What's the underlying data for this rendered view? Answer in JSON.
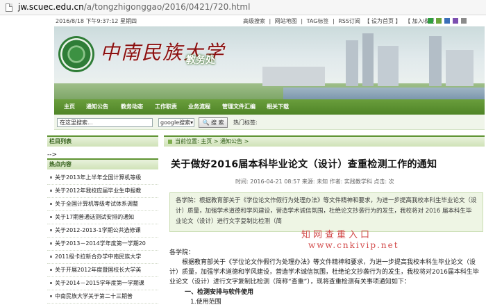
{
  "browser": {
    "url_host": "jw.scuec.edu.cn",
    "url_path": "/a/tongzhigonggao/2016/0421/720.html"
  },
  "topbar": {
    "datetime": "2016/8/18 下午9:37:12 星期四",
    "links": [
      "高级搜索",
      "|",
      "网站地图",
      "|",
      "TAG标签",
      "|",
      "RSS订阅",
      "【 设为首页 】",
      "【 加入收藏 】"
    ],
    "swatch_colors": [
      "#2e9e3e",
      "#6aa53a",
      "#3a6fb8",
      "#7c4fb0",
      "#8b8b8b"
    ]
  },
  "banner": {
    "university_name": "中南民族大学",
    "department": "教务处"
  },
  "nav": {
    "items": [
      "主页",
      "通知公告",
      "教务动态",
      "工作职责",
      "业务流程",
      "管理文件汇编",
      "相关下载"
    ]
  },
  "search": {
    "placeholder": "在这里搜索...",
    "engine": "google搜索",
    "button": "搜 索",
    "hot_label": "热门标签:"
  },
  "sidebar": {
    "column_header": "栏目列表",
    "arrow_text": "-->",
    "hot_header": "热点内容",
    "items": [
      "关于2013年上半年全国计算机等级",
      "关于2012年我校应届毕业生申报教",
      "关于全国计算机等级考试体系调整",
      "关于17期普通话测试安排的通知",
      "关于2012-2013-1学期公共选修课",
      "关于2013－2014学年度第一学期20",
      "2011级卡拉新合办学中南民族大学",
      "关于开展2012年度暨国校长大学英",
      "关于2014－2015学年度第一学期课",
      "中南民族大学关于第二十三期普"
    ]
  },
  "breadcrumb": {
    "label": "当前位置:",
    "home": "主页",
    "sep1": ">",
    "section": "通知公告",
    "sep2": ">"
  },
  "article": {
    "title": "关于做好2016届本科毕业论文（设计）查重检测工作的通知",
    "meta": "时间: 2016-04-21 08:57  来源: 未知  作者: 实践教学科  点击: 次",
    "summary": "各学院：根据教育部关于《学位论文作假行为处理办法》等文件精神和要求，为进一步提高我校本科生毕业论文（设计）质量，加强学术道德和学风建设，营造学术诚信氛围，杜绝论文抄袭行为的发生，我校将对 2016 届本科生毕业论文（设计）进行文字复制比检测（简",
    "watermark_line1": "知网查重入口",
    "watermark_line2": "www.cnkivip.net",
    "salutation": "各学院：",
    "paragraph": "根据教育部关于《学位论文作假行为处理办法》等文件精神和要求，为进一步提高我校本科生毕业论文（设计）质量，加强学术道德和学风建设，营造学术诚信氛围，杜绝论文抄袭行为的发生，我校将对2016届本科生毕业论文（设计）进行文字复制比检测（简称“查重”），现将查重检测有关事项通知如下：",
    "heading1": "一、检测安排与软件使用",
    "heading2": "1.使用范围"
  }
}
